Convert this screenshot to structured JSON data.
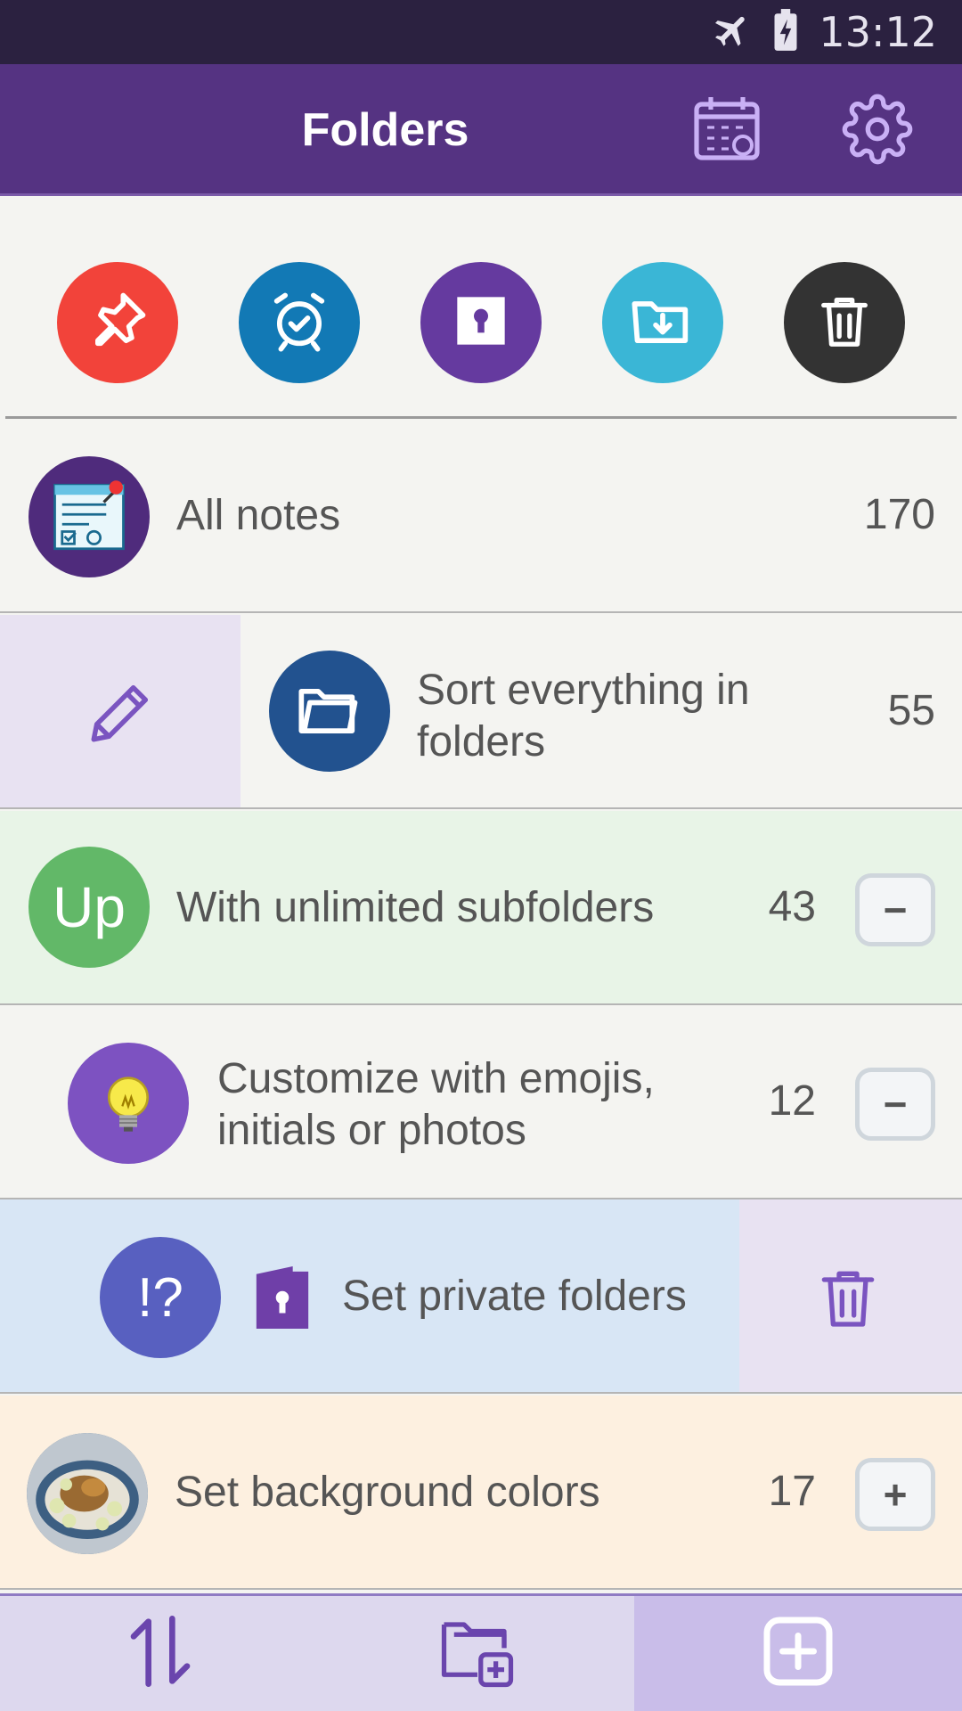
{
  "status_bar": {
    "time": "13:12",
    "icons": [
      "airplane-icon",
      "battery-charging-icon"
    ]
  },
  "app_bar": {
    "title": "Folders",
    "actions": [
      "calendar-icon",
      "gear-icon"
    ]
  },
  "quick_filters": [
    {
      "icon": "pin-icon",
      "color": "#f2433a"
    },
    {
      "icon": "alarm-clock-icon",
      "color": "#1279b5"
    },
    {
      "icon": "keyhole-lock-icon",
      "color": "#653a9f"
    },
    {
      "icon": "folder-download-icon",
      "color": "#3ab6d6"
    },
    {
      "icon": "trash-icon",
      "color": "#333333"
    }
  ],
  "folders": [
    {
      "label": "All notes",
      "count": "170",
      "icon": "notes-icon",
      "avatar_color": "#4f2b7c",
      "bg": "#f4f4f1"
    },
    {
      "label_line1": "Sort everything in",
      "label_line2": "folders",
      "count": "55",
      "icon": "folder-icon",
      "avatar_color": "#22528f",
      "bg": "#f4f4f1",
      "swipe_action": "pencil-icon",
      "swipe_bg": "#e8e2f2"
    },
    {
      "label": "With unlimited subfolders",
      "count": "43",
      "avatar_text": "Up",
      "avatar_color": "#62b868",
      "bg": "#e8f4e7",
      "toggle": "−"
    },
    {
      "label_line1": "Customize with emojis,",
      "label_line2": "initials or photos",
      "count": "12",
      "icon": "lightbulb-icon",
      "avatar_color": "#7d52c1",
      "bg": "#f4f4f1",
      "toggle": "−"
    },
    {
      "label": "Set private folders",
      "avatar_text": "!?",
      "avatar_color": "#5860c0",
      "bg": "#d8e6f5",
      "badge_icon": "private-lock-icon",
      "swipe_action": "trash-icon",
      "swipe_bg": "#e8e2f2"
    },
    {
      "label": "Set background colors",
      "count": "17",
      "icon": "food-photo-icon",
      "bg": "#fdf0e0",
      "toggle": "+"
    }
  ],
  "bottom_bar": {
    "actions": [
      "sort-arrows-icon",
      "new-subfolder-icon",
      "add-icon"
    ],
    "active_bg": "#c9bde9"
  }
}
